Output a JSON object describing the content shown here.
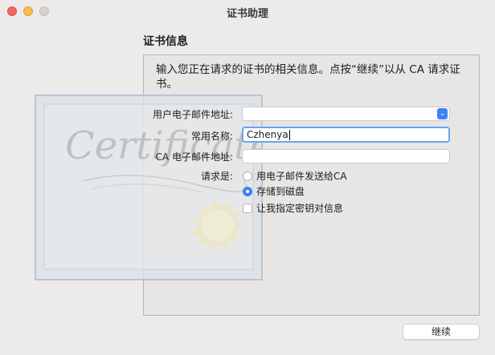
{
  "window": {
    "title": "证书助理"
  },
  "section": {
    "title": "证书信息",
    "intro": "输入您正在请求的证书的相关信息。点按“继续”以从 CA 请求证书。"
  },
  "certificate_graphic": {
    "text": "Certificate"
  },
  "form": {
    "user_email_label": "用户电子邮件地址:",
    "user_email_value": "",
    "common_name_label": "常用名称:",
    "common_name_value": "Czhenya",
    "ca_email_label": "CA 电子邮件地址:",
    "ca_email_value": "",
    "request_label": "请求是:",
    "request_options": [
      {
        "label": "用电子邮件发送给CA",
        "selected": false
      },
      {
        "label": "存储到磁盘",
        "selected": true
      }
    ],
    "key_pair_checkbox_label": "让我指定密钥对信息",
    "key_pair_checked": false
  },
  "buttons": {
    "continue_label": "继续"
  },
  "colors": {
    "accent": "#3b82f6",
    "window_bg": "#ecebea",
    "close_light": "#ee6a5f",
    "minimize_light": "#f5be4f"
  }
}
